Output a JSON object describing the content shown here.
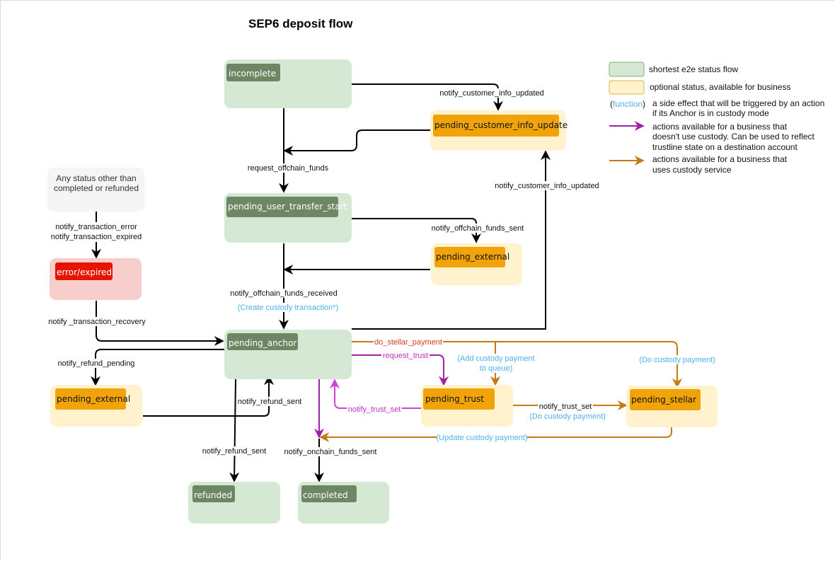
{
  "title": "SEP6 deposit flow",
  "colors": {
    "green_container": "#d5e8d4",
    "green_chip": "#6d8764",
    "yellow_container": "#fff2cc",
    "orange_chip": "#f0a30a",
    "red_container": "#f8cecc",
    "red_chip": "#e51400",
    "gray_container": "#f5f5f5",
    "black_arrow": "#000000",
    "custody_arrow": "#c47a12",
    "non_custody_arrow": "#a020a8",
    "function_text": "#4db0f0"
  },
  "states": {
    "incomplete": "incomplete",
    "pending_customer_info_update": "pending_customer_info_update",
    "pending_user_transfer_start": "pending_user_transfer_start",
    "pending_external_top": "pending_external",
    "pending_anchor": "pending_anchor",
    "error_expired": "error/expired",
    "any_status_note": [
      "Any status other than",
      "completed or refunded"
    ],
    "pending_external_left": "pending_external",
    "pending_trust": "pending_trust",
    "pending_stellar": "pending_stellar",
    "refunded": "refunded",
    "completed": "completed"
  },
  "transitions": {
    "incomplete_to_pciu": "notify_customer_info_updated",
    "request_offchain_funds": "request_offchain_funds",
    "anchor_to_pciu": "notify_customer_info_updated",
    "notify_offchain_funds_sent": "notify_offchain_funds_sent",
    "notify_offchain_funds_received": "notify_offchain_funds_received",
    "create_custody_transaction": "(Create custody transaction*)",
    "notify_transaction_error": "notify_transaction_error",
    "notify_transaction_expired": "notify_transaction_expired",
    "notify_transaction_recovery": "notify _transaction_recovery",
    "notify_refund_pending": "notify_refund_pending",
    "notify_refund_sent_up": "notify_refund_sent",
    "notify_refund_sent_down": "notify_refund_sent",
    "notify_onchain_funds_sent": "notify_onchain_funds_sent",
    "do_stellar_payment": "do_stellar_payment",
    "request_trust": "request_trust",
    "add_custody_payment_1": "(Add custody payment",
    "add_custody_payment_2": "to queue)",
    "do_custody_payment_top": "(Do custody payment)",
    "notify_trust_set_back": "notify_trust_set",
    "notify_trust_set_fwd": "notify_trust_set",
    "do_custody_payment_mid": "(Do custody payment)",
    "update_custody_payment": "(Update custody payment)"
  },
  "legend": {
    "green": "shortest e2e status flow",
    "yellow": "optional status, available for business",
    "function_sample": "function",
    "function_open": "(",
    "function_close": ")",
    "function_desc": [
      "a side effect that will be triggered by an action",
      "if its Anchor is in custody mode"
    ],
    "purple_desc": [
      "actions available for a business that",
      "doesn't use custody. Can be used to reflect",
      "trustline state on a destination account"
    ],
    "orange_desc": [
      "actions available for a business that",
      "uses custody service"
    ]
  }
}
